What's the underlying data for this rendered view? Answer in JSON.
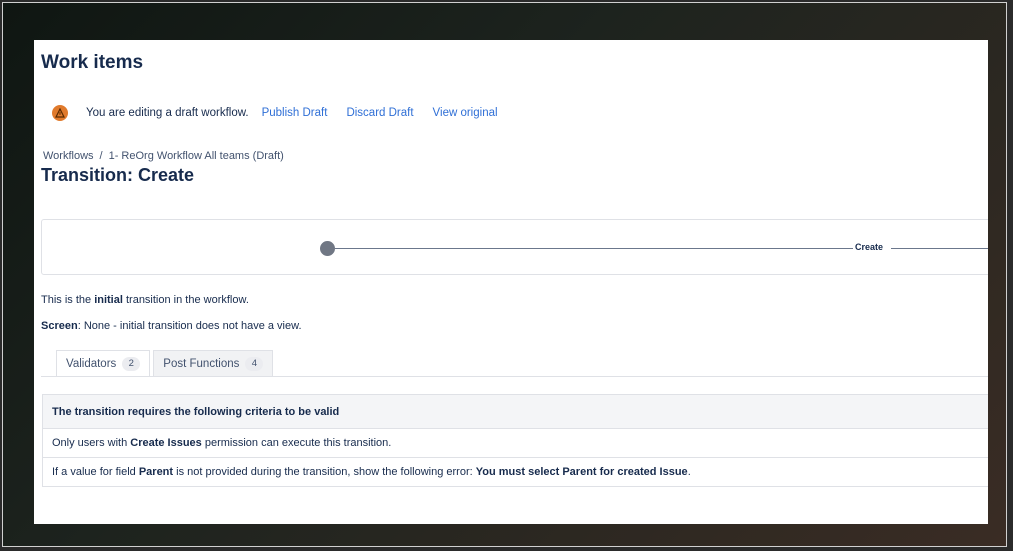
{
  "page": {
    "title": "Work items"
  },
  "draft_bar": {
    "icon": "warning-icon",
    "message": "You are editing a draft workflow.",
    "links": [
      "Publish Draft",
      "Discard Draft",
      "View original"
    ]
  },
  "breadcrumb": {
    "items": [
      "Workflows",
      "1- ReOrg Workflow All teams (Draft)"
    ],
    "separator": "/"
  },
  "transition": {
    "title": "Transition: Create",
    "diagram_label": "Create"
  },
  "info": {
    "line1_prefix": "This is the ",
    "line1_bold": "initial",
    "line1_suffix": " transition in the workflow.",
    "line2_bold": "Screen",
    "line2_suffix": ": None - initial transition does not have a view."
  },
  "tabs": [
    {
      "label": "Validators",
      "count": "2",
      "active": true
    },
    {
      "label": "Post Functions",
      "count": "4",
      "active": false
    }
  ],
  "criteria": {
    "header": "The transition requires the following criteria to be valid",
    "row1": {
      "prefix": "Only users with ",
      "bold": "Create Issues",
      "suffix": " permission can execute this transition."
    },
    "row2": {
      "prefix": "If a value for field ",
      "bold1": "Parent",
      "middle": " is not provided during the transition, show the following error: ",
      "bold2": "You must select Parent for created Issue",
      "suffix": "."
    }
  },
  "colors": {
    "link": "#2f6fd6",
    "warning": "#e07a2c",
    "text": "#172b4d"
  }
}
